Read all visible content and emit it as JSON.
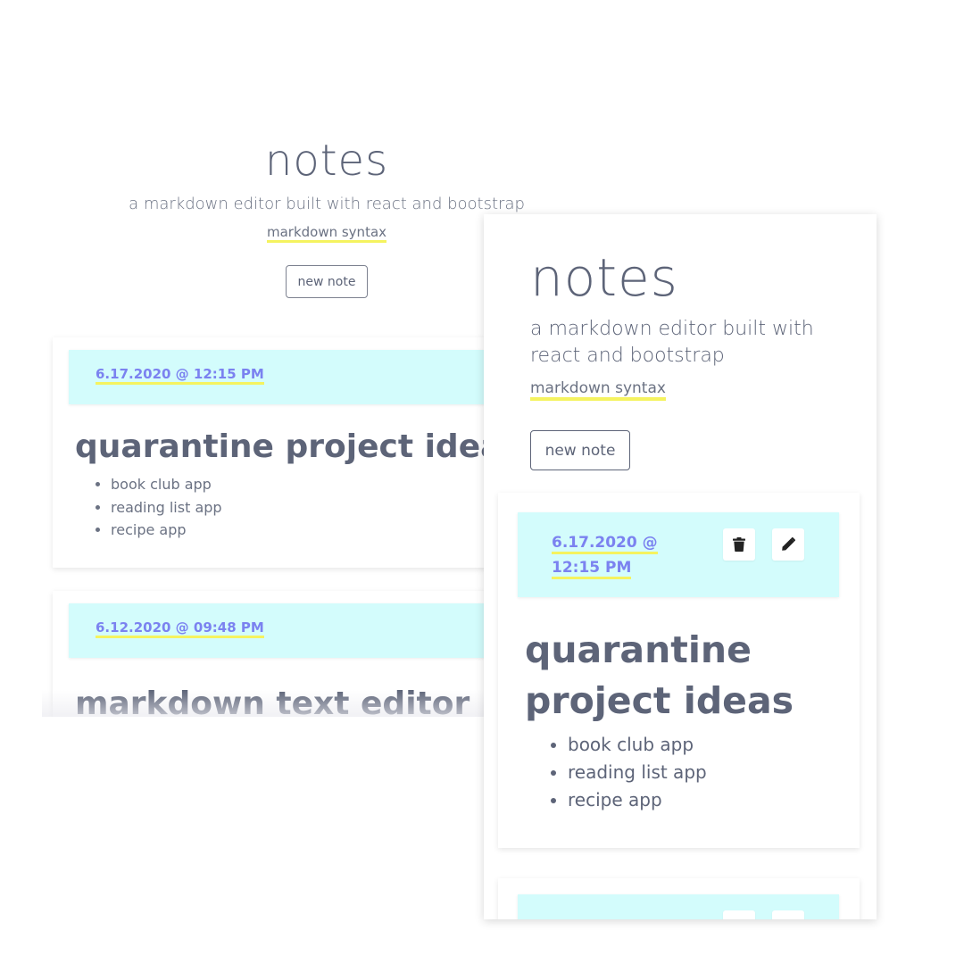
{
  "app": {
    "title": "notes",
    "subtitle": "a markdown editor built with react and bootstrap",
    "syntax_link": "markdown syntax",
    "new_note_label": "new note"
  },
  "desktop_notes": [
    {
      "date": "6.17.2020 @ 12:15 PM",
      "title": "quarantine project ideas",
      "items": [
        "book club app",
        "reading list app",
        "recipe app"
      ]
    },
    {
      "date": "6.12.2020 @ 09:48 PM",
      "title": "markdown text editor"
    }
  ],
  "mobile_notes": [
    {
      "date": "6.17.2020 @ 12:15 PM",
      "title": "quarantine project ideas",
      "items": [
        "book club app",
        "reading list app",
        "recipe app"
      ],
      "actions": [
        "trash-icon",
        "pencil-icon"
      ]
    }
  ],
  "colors": {
    "text": "#5d6478",
    "date": "#7b82f0",
    "highlight": "#f5f35f",
    "card_header": "#d3fcfc"
  }
}
